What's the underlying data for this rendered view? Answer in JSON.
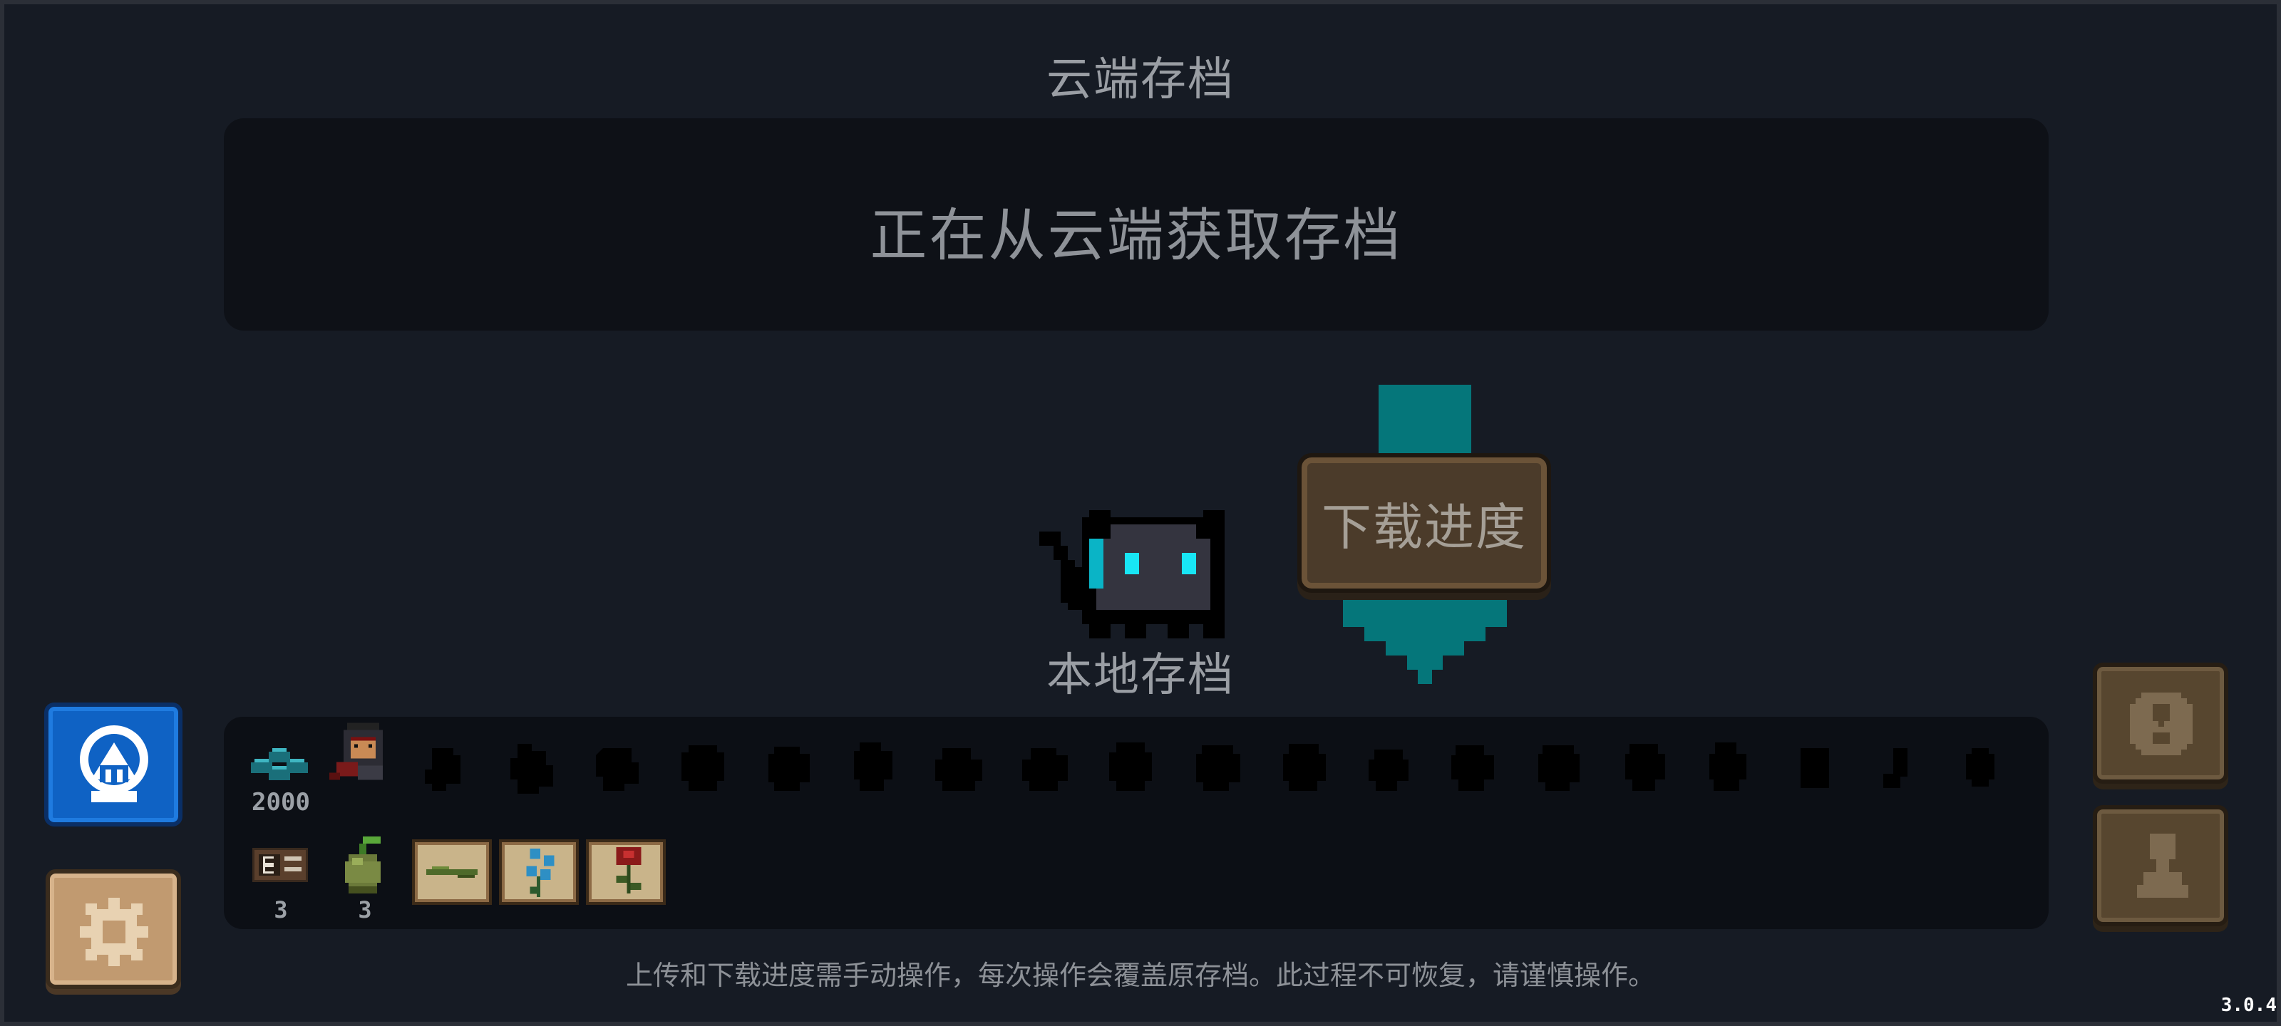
{
  "header": {
    "title": "云端存档"
  },
  "status": {
    "message": "正在从云端获取存档"
  },
  "download": {
    "label": "下载进度"
  },
  "local": {
    "label": "本地存档"
  },
  "inventory": {
    "gems": "2000",
    "materials": [
      {
        "icon": "material-card-icon",
        "count": "3"
      },
      {
        "icon": "seed-icon",
        "count": "3"
      }
    ],
    "plant_cards": [
      "grass-plant-icon",
      "blue-flower-icon",
      "red-flower-icon"
    ],
    "character_silhouettes": 19
  },
  "footer": {
    "notice": "上传和下载进度需手动操作，每次操作会覆盖原存档。此过程不可恢复，请谨慎操作。"
  },
  "version": "3.0.4",
  "colors": {
    "accent_teal": "#05767a",
    "brand_blue": "#0f62c4",
    "wood": "#4b3b2a"
  }
}
